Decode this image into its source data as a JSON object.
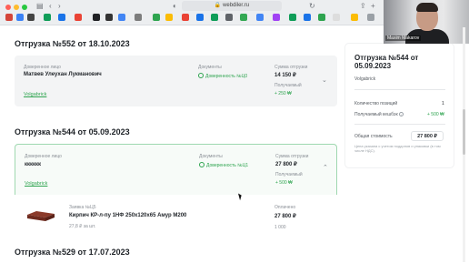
{
  "browser": {
    "url": "webdiler.ru",
    "colors": {
      "chrome": "#eceef0",
      "close": "#ff5f57",
      "minimize": "#febc2e",
      "maximize": "#28c840"
    }
  },
  "orders": [
    {
      "title": "Отгрузка №552 от 18.10.2023",
      "trusted_label": "Доверенное лицо",
      "trusted_value": "Матвев Улеухан Лукманович",
      "docs_label": "Документы",
      "docs_value": "Доверенность №Ц0",
      "sum_label": "Сумма отгрузки",
      "sum_value": "14 150 ₽",
      "received_label": "Получаемый",
      "received_value": "+ 250 ₩",
      "supplier": "Volgabrick"
    },
    {
      "title": "Отгрузка №544 от 05.09.2023",
      "trusted_label": "Доверенное лицо",
      "trusted_value": "кккккк",
      "docs_label": "Документы",
      "docs_value": "Доверенность №Ц1",
      "sum_label": "Сумма отгрузки",
      "sum_value": "27 800 ₽",
      "received_label": "Получаемый",
      "received_value": "+ 500 ₩",
      "supplier": "Volgabrick",
      "product": {
        "order_no": "Заявка №Ц5",
        "name": "Кирпич КР-л-пу 1НФ 250x120x65 Амур М200",
        "price": "27,8 ₽ за шт.",
        "paid_label": "Оплачено",
        "paid_value": "27 800 ₽",
        "qty": "1 000"
      }
    },
    {
      "title": "Отгрузка №529 от 17.07.2023"
    }
  ],
  "side": {
    "title": "Отгрузка №544 от 05.09.2023",
    "supplier": "Volgabrick",
    "positions_label": "Количество позиций",
    "positions_value": "1",
    "cashback_label": "Получаемый кешбэк",
    "cashback_value": "+ 500 ₩",
    "total_label": "Общая стоимость",
    "total_value": "27 800 ₽",
    "note": "Цена указана с учетом поддонов и упаковки (в том числе НДС)."
  },
  "video": {
    "name": "Maxim Makarov"
  },
  "accent_green": "#2ea44f"
}
